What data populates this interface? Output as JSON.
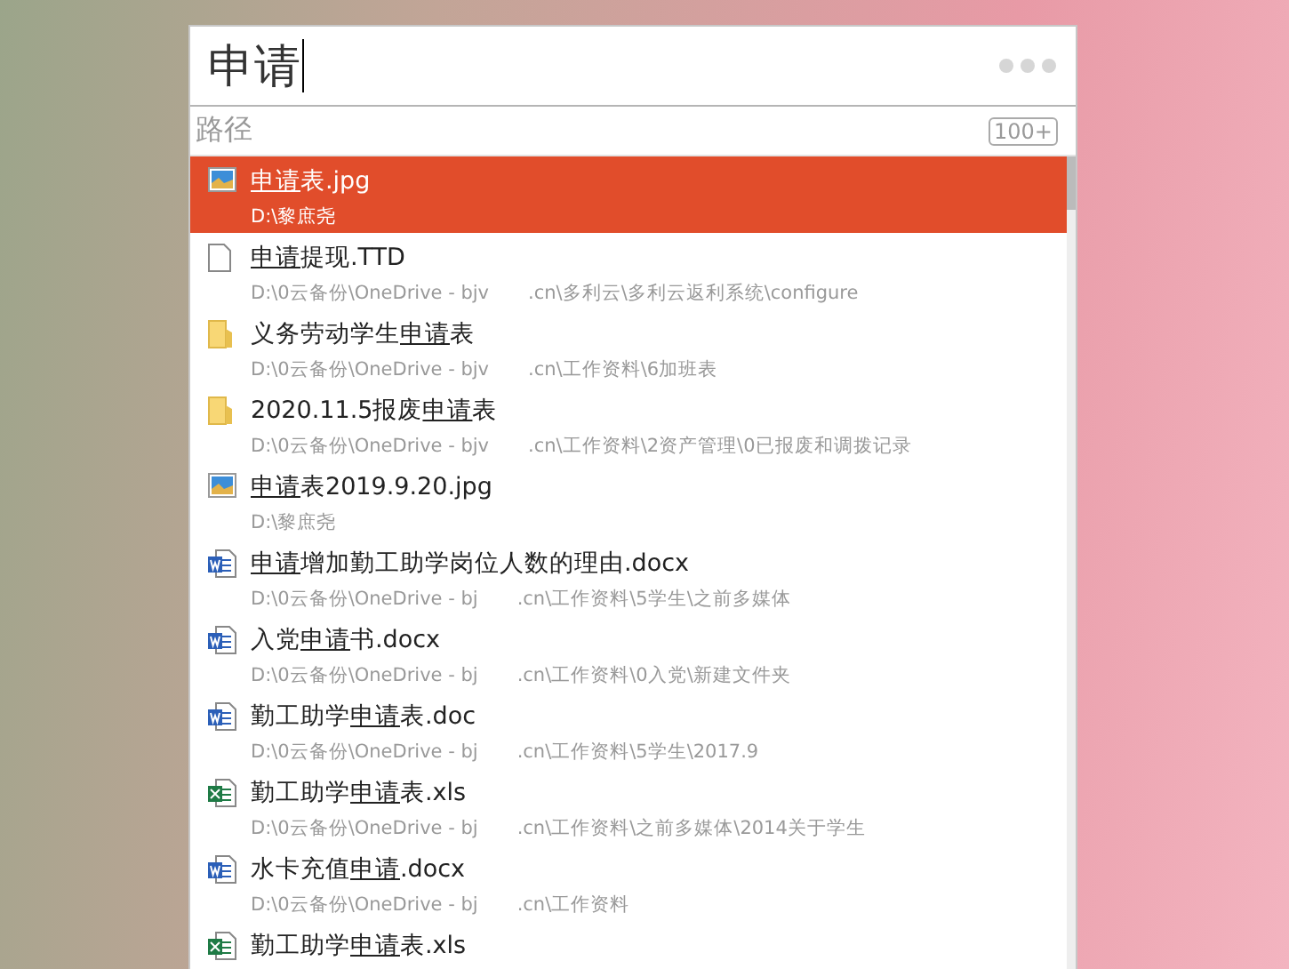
{
  "search": {
    "value": "申请"
  },
  "filter": {
    "label": "路径",
    "count": "100+"
  },
  "results": [
    {
      "kind": "image",
      "selected": true,
      "match": "申请",
      "after": "表.jpg",
      "path": [
        "D:\\黎庶尧"
      ]
    },
    {
      "kind": "file",
      "selected": false,
      "match": "申请",
      "after": "提现.TTD",
      "path": [
        "D:\\0云备份\\OneDrive - bjv",
        ".cn\\多利云\\多利云返利系统\\configure"
      ]
    },
    {
      "kind": "folder",
      "selected": false,
      "before": "义务劳动学生",
      "match": "申请",
      "after": "表",
      "path": [
        "D:\\0云备份\\OneDrive - bjv",
        ".cn\\工作资料\\6加班表"
      ]
    },
    {
      "kind": "folder",
      "selected": false,
      "before": "2020.11.5报废",
      "match": "申请",
      "after": "表",
      "path": [
        "D:\\0云备份\\OneDrive - bjv",
        ".cn\\工作资料\\2资产管理\\0已报废和调拨记录"
      ]
    },
    {
      "kind": "image",
      "selected": false,
      "match": "申请",
      "after": "表2019.9.20.jpg",
      "path": [
        "D:\\黎庶尧"
      ]
    },
    {
      "kind": "word",
      "selected": false,
      "match": "申请",
      "after": "增加勤工助学岗位人数的理由.docx",
      "path": [
        "D:\\0云备份\\OneDrive - bj",
        ".cn\\工作资料\\5学生\\之前多媒体"
      ]
    },
    {
      "kind": "word",
      "selected": false,
      "before": "入党",
      "match": "申请",
      "after": "书.docx",
      "path": [
        "D:\\0云备份\\OneDrive - bj",
        ".cn\\工作资料\\0入党\\新建文件夹"
      ]
    },
    {
      "kind": "word",
      "selected": false,
      "before": "勤工助学",
      "match": "申请",
      "after": "表.doc",
      "path": [
        "D:\\0云备份\\OneDrive - bj",
        ".cn\\工作资料\\5学生\\2017.9"
      ]
    },
    {
      "kind": "excel",
      "selected": false,
      "before": "勤工助学",
      "match": "申请",
      "after": "表.xls",
      "path": [
        "D:\\0云备份\\OneDrive - bj",
        ".cn\\工作资料\\之前多媒体\\2014关于学生"
      ]
    },
    {
      "kind": "word",
      "selected": false,
      "before": "水卡充值",
      "match": "申请",
      "after": ".docx",
      "path": [
        "D:\\0云备份\\OneDrive - bj",
        ".cn\\工作资料"
      ]
    },
    {
      "kind": "excel",
      "selected": false,
      "before": "勤工助学",
      "match": "申请",
      "after": "表.xls"
    }
  ]
}
